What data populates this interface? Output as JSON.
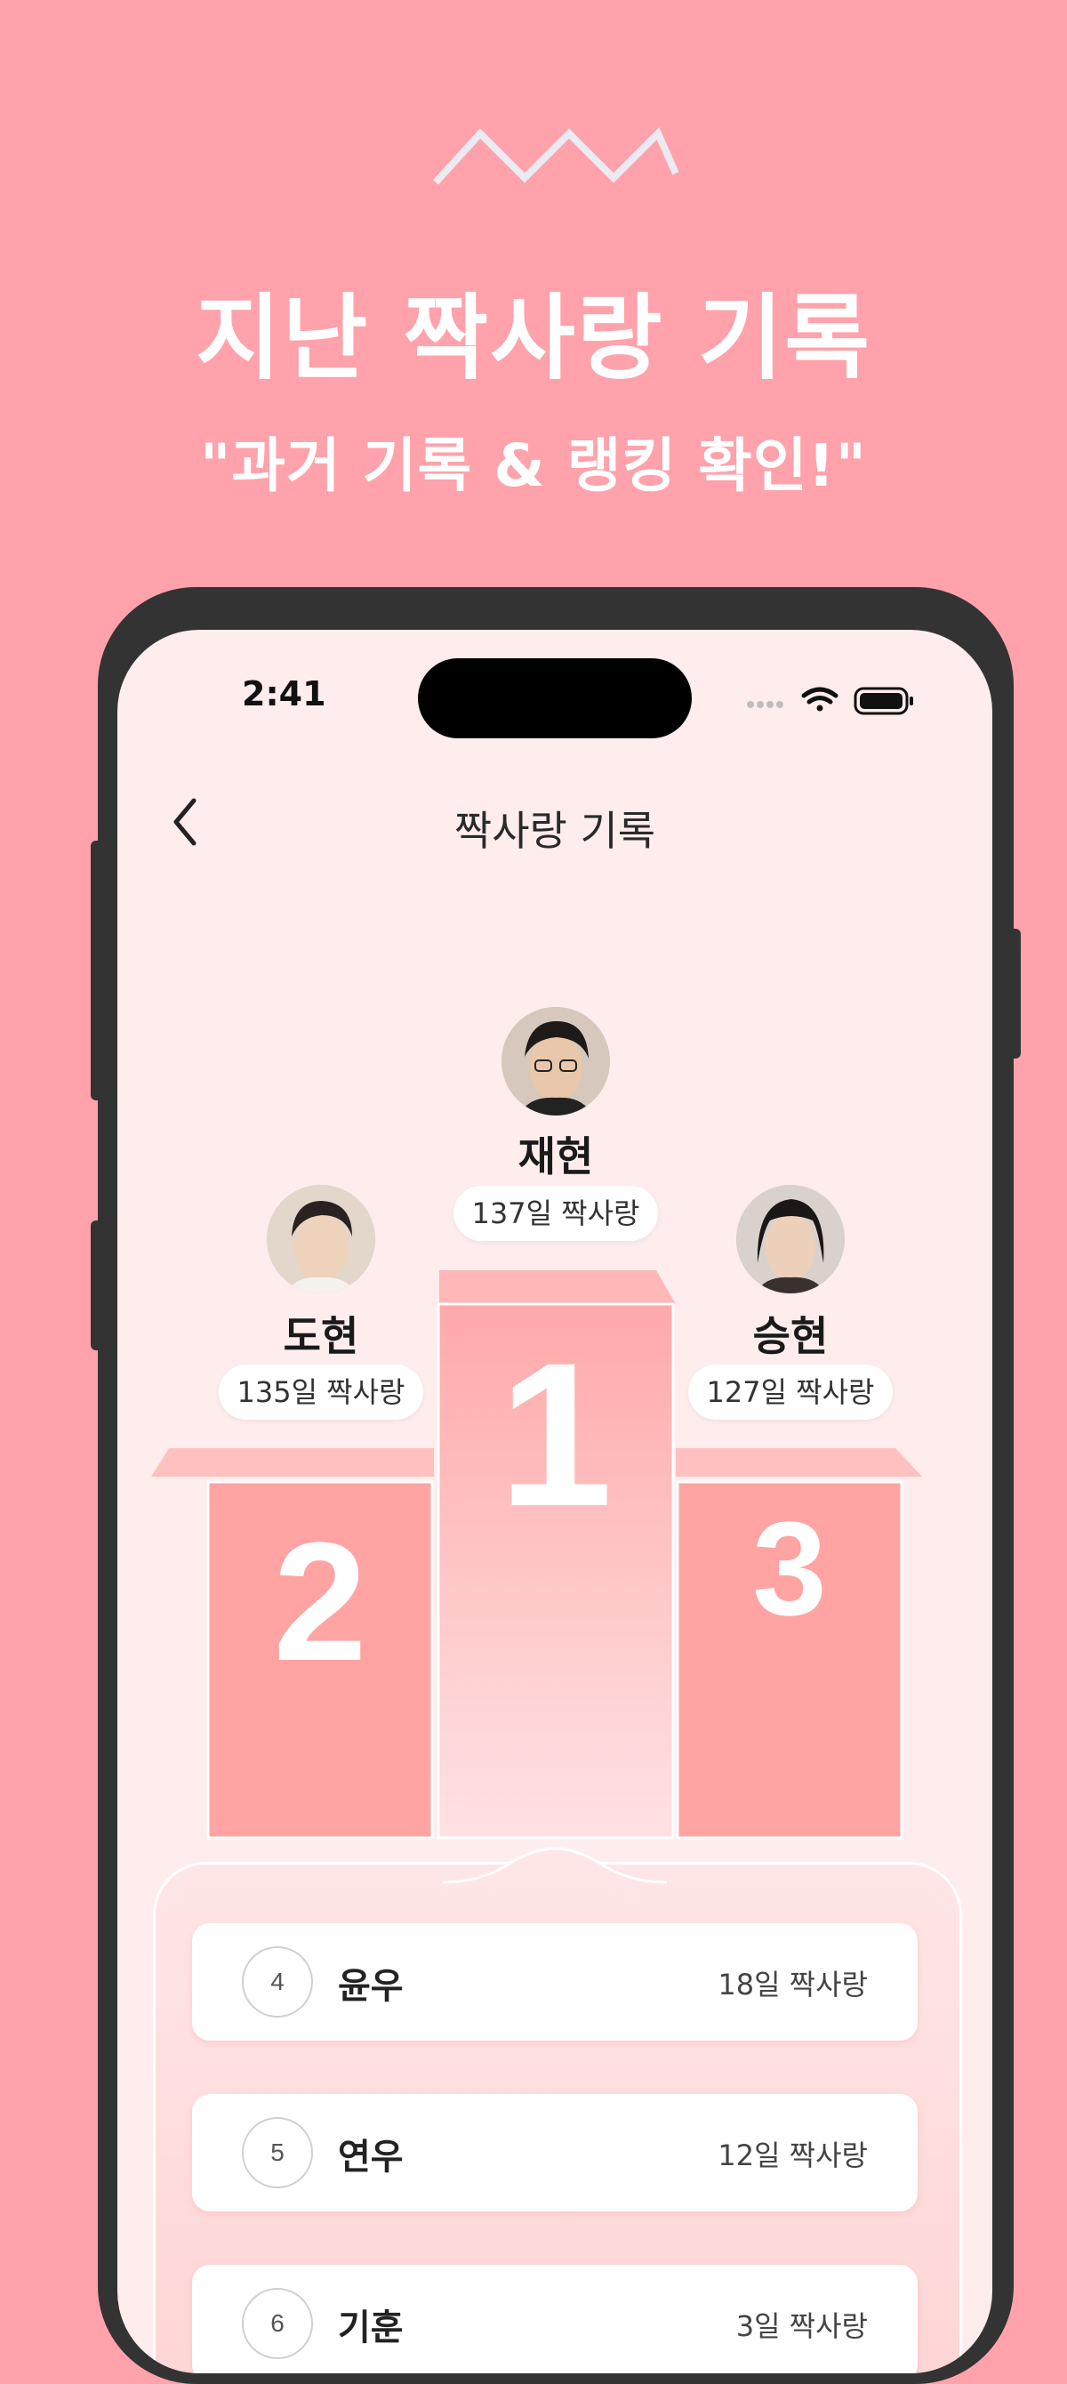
{
  "promo": {
    "headline": "지난 짝사랑 기록",
    "subline": "\"과거 기록 & 랭킹 확인!\""
  },
  "status_bar": {
    "time": "2:41",
    "icons": [
      "signal-dots-icon",
      "wifi-icon",
      "battery-icon"
    ]
  },
  "nav": {
    "title": "짝사랑 기록",
    "back_icon": "chevron-left-icon"
  },
  "podium": [
    {
      "rank": "1",
      "name": "재현",
      "days": "137일 짝사랑"
    },
    {
      "rank": "2",
      "name": "도현",
      "days": "135일 짝사랑"
    },
    {
      "rank": "3",
      "name": "승현",
      "days": "127일 짝사랑"
    }
  ],
  "ranking_list": [
    {
      "rank": "4",
      "name": "윤우",
      "days": "18일 짝사랑"
    },
    {
      "rank": "5",
      "name": "연우",
      "days": "12일 짝사랑"
    },
    {
      "rank": "6",
      "name": "기훈",
      "days": "3일 짝사랑"
    }
  ],
  "colors": {
    "background": "#FFA2AB",
    "screen": "#FFEDED",
    "podium_side": "#FFA3A3",
    "podium_center_top": "#FFA9A9",
    "podium_center_bottom": "#FFE2E4",
    "frame": "#333333"
  }
}
